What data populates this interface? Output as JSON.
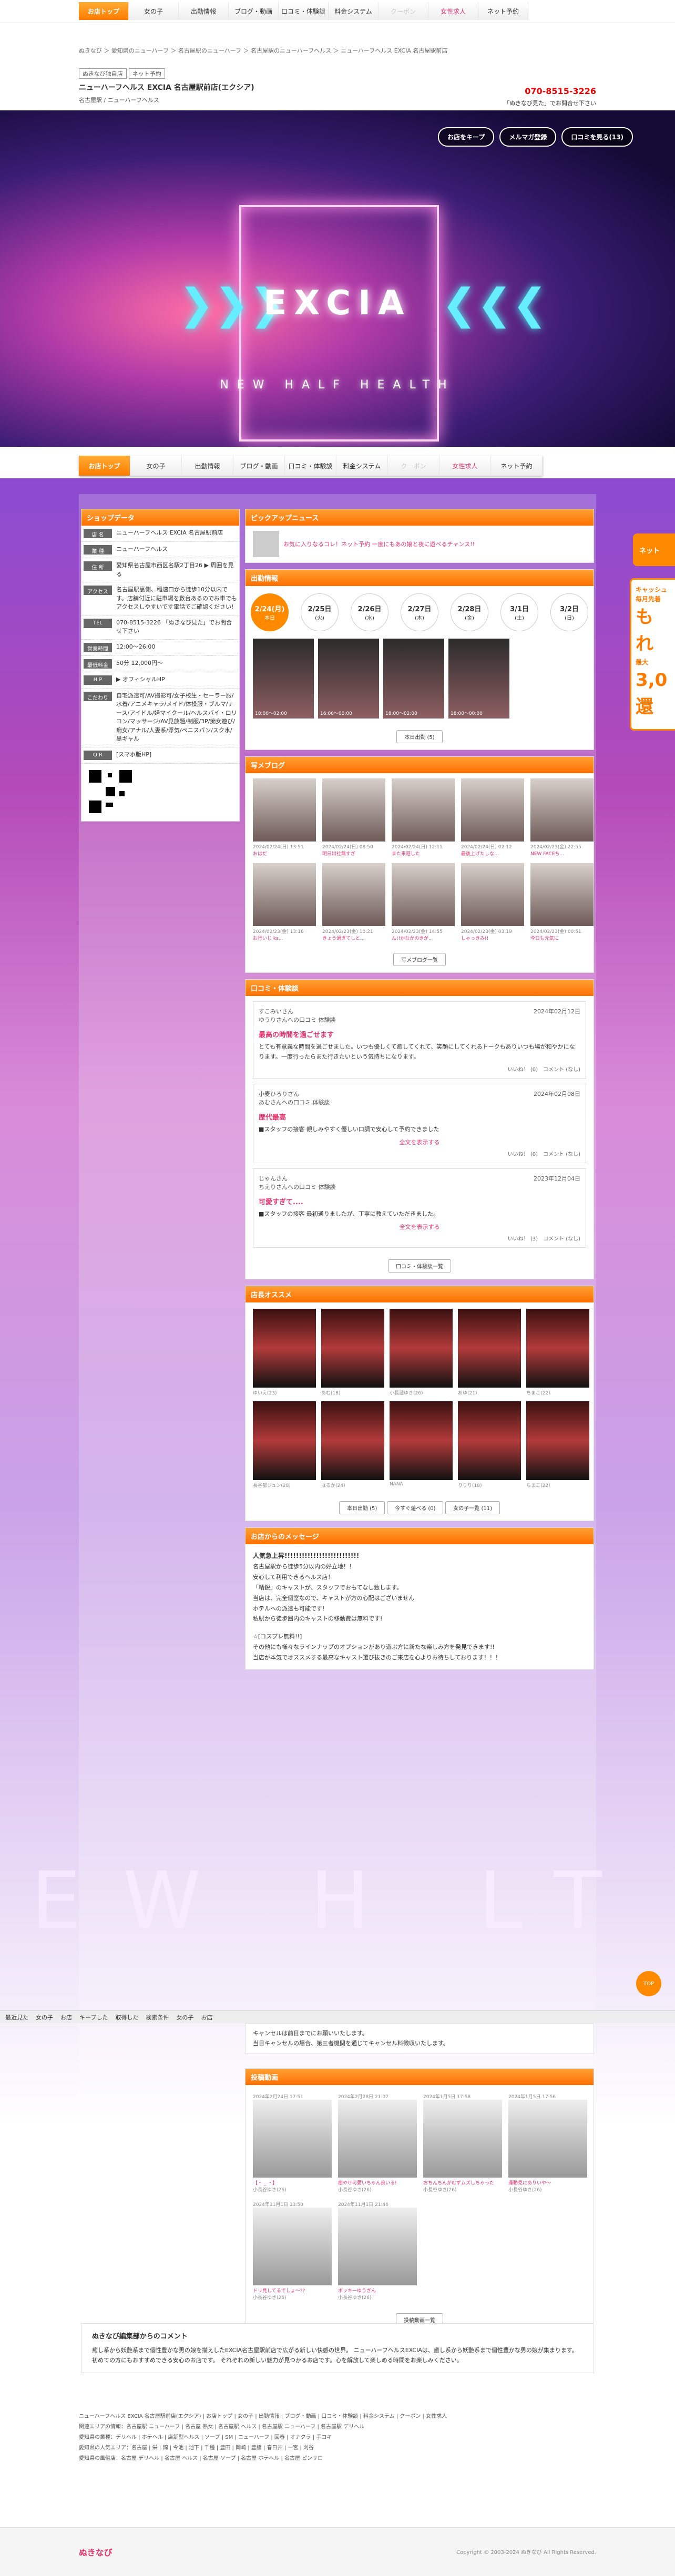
{
  "topnav": {
    "logo": "ぬきなび",
    "items": [
      "お店トップ",
      "女の子",
      "出勤情報",
      "ブログ・動画",
      "口コミ・体験談",
      "料金システム",
      "クーポン",
      "女性求人",
      "ネット予約"
    ]
  },
  "breadcrumb": "ぬきなび ＞ 愛知県のニューハーフ ＞ 名古屋駅のニューハーフ ＞ 名古屋駅のニューハーフヘルス ＞ ニューハーフヘルス EXCIA 名古屋駅前店",
  "shop": {
    "tags": [
      "ぬきなび独自店",
      "ネット予約"
    ],
    "name": "ニューハーフヘルス EXCIA 名古屋駅前店(エクシア)",
    "sub": "名古屋駅 / ニューハーフヘルス",
    "phone": "070-8515-3226",
    "phone_note": "「ぬきなび見た」でお問合せ下さい"
  },
  "hero": {
    "buttons": [
      "お店をキープ",
      "メルマガ登録",
      "口コミを見る(13)"
    ],
    "brand": "EXCIA",
    "tagline": "NEW HALF HEALTH",
    "chev_left": "❯❯❯",
    "chev_right": "❮❮❮"
  },
  "shopdata": {
    "title": "ショップデータ",
    "rows": [
      {
        "k": "店 名",
        "v": "ニューハーフヘルス EXCIA 名古屋駅前店"
      },
      {
        "k": "業 種",
        "v": "ニューハーフヘルス"
      },
      {
        "k": "住 所",
        "v": "愛知県名古屋市西区名駅2丁目26 ▶ 周囲を見る"
      },
      {
        "k": "アクセス",
        "v": "名古屋駅裏側、稲速口から徒歩10分以内です。店舗付近に駐車場を数台あるのでお車でもアクセスしやすいです電話でご確認ください!"
      },
      {
        "k": "TEL",
        "v": "070-8515-3226 「ぬきなび見た」でお問合せ下さい"
      },
      {
        "k": "営業時間",
        "v": "12:00〜26:00"
      },
      {
        "k": "最低料金",
        "v": "50分 12,000円〜"
      },
      {
        "k": "H P",
        "v": "▶ オフィシャルHP"
      },
      {
        "k": "こだわり",
        "v": "自宅派遣可/AV撮影可/女子校生・セーラー服/水着/アニメキャラ/メイド/体操服・ブルマ/ナース/アイドル/婦マイクール/ヘルスバイ・ロリコン/マッサージ/AV見放題/制服/3P/痴女遊び/痴女/アナル/人妻系/浮気/ペニスパン/スク水/黒ギャル"
      },
      {
        "k": "Q R",
        "v": "[スマホ版HP]"
      }
    ]
  },
  "pickup": {
    "title": "ピックアップニュース",
    "text": "お気に入りなるコレ！ネット予約 一度にもあの娘と夜に遊べるチャンス!!"
  },
  "schedule": {
    "title": "出勤情報",
    "days": [
      {
        "d": "2/24(月)",
        "s": "本日"
      },
      {
        "d": "2/25日",
        "s": "(火)"
      },
      {
        "d": "2/26日",
        "s": "(水)"
      },
      {
        "d": "2/27日",
        "s": "(木)"
      },
      {
        "d": "2/28日",
        "s": "(金)"
      },
      {
        "d": "3/1日",
        "s": "(土)"
      },
      {
        "d": "3/2日",
        "s": "(日)"
      }
    ],
    "girls": [
      "18:00〜02:00",
      "16:00〜00:00",
      "18:00〜02:00",
      "18:00〜00:00"
    ],
    "btn": "本日出勤 (5)"
  },
  "blog": {
    "title": "写メブログ",
    "items": [
      {
        "t": "2024/02/24(日) 13:51",
        "n": "おはだ"
      },
      {
        "t": "2024/02/24(日) 08:50",
        "n": "明日出社無すぎ"
      },
      {
        "t": "2024/02/24(日) 12:11",
        "n": "また来遊した"
      },
      {
        "t": "2024/02/24(日) 02:12",
        "n": "最後上げたしな..."
      },
      {
        "t": "2024/02/23(金) 22:55",
        "n": "NEW FACEち..."
      },
      {
        "t": "2024/02/23(金) 13:16",
        "n": "お行いじ ks..."
      },
      {
        "t": "2024/02/23(金) 10:21",
        "n": "きょう過ぎてしと..."
      },
      {
        "t": "2024/02/23(金) 14:55",
        "n": "ん!!かなかのきが.."
      },
      {
        "t": "2024/02/23(金) 03:19",
        "n": "しゃっきみ!!"
      },
      {
        "t": "2024/02/23(金) 00:51",
        "n": "今日も元気に"
      }
    ],
    "btn": "写メブログ一覧"
  },
  "reviews": {
    "title": "口コミ・体験談",
    "items": [
      {
        "u": "すこみいさん",
        "to": "ゆうりさんへの口コミ 体験談",
        "date": "2024年02月12日",
        "title": "最高の時間を過ごせます",
        "body": "とても有意義な時間を過ごせました。いつも優しくて癒してくれて、笑顔にしてくれるトークもありいつも場が和やかになります。一度行ったらまた行きたいという気持ちになります。",
        "more": "",
        "likes": "いいね！ (0)",
        "cmt": "コメント (なし)"
      },
      {
        "u": "小麦ひろりさん",
        "to": "あむさんへの口コミ 体験談",
        "date": "2024年02月08日",
        "title": "歴代最高",
        "body": "■スタッフの接客 親しみやすく優しい口調で安心して予約できました",
        "more": "全文を表示する",
        "likes": "いいね！ (0)",
        "cmt": "コメント (なし)"
      },
      {
        "u": "じゃんさん",
        "to": "ちえりさんへの口コミ 体験談",
        "date": "2023年12月04日",
        "title": "可愛すぎて....",
        "body": "■スタッフの接客 最初通りましたが、丁寧に教えていただきました。",
        "more": "全文を表示する",
        "likes": "いいね！ (3)",
        "cmt": "コメント (なし)"
      }
    ],
    "btn": "口コミ・体験談一覧"
  },
  "recommend": {
    "title": "店長オススメ",
    "girls": [
      "ゆいえ(23)",
      "あむ(18)",
      "小長遊ゆき(26)",
      "あゆ(21)",
      "ちまこ(22)",
      "長谷部ジュン(28)",
      "はるか(24)",
      "NANA",
      "りりり(18)",
      "ちまこ(22)"
    ],
    "btns": [
      "本日出勤 (5)",
      "今すぐ遊べる (0)",
      "女の子一覧 (11)"
    ]
  },
  "message": {
    "title": "お店からのメッセージ",
    "heading": "人気急上昇!!!!!!!!!!!!!!!!!!!!!!!!!!",
    "lines": [
      "名古屋駅から徒歩5分以内の好立地！！",
      "安心して利用できるヘルス店！",
      "「精鋭」のキャストが、スタッフでおもてなし致します。",
      "当店は、完全個室なので、キャストが方の心配はございません",
      "ホテルへの派遣も可能です!",
      "私駅から徒歩圏内のキャストの移動費は無料です!",
      "",
      "☆[コスプレ無料!!]",
      "その他にも様々なラインナップのオプションがあり遊ぶ方に新たな楽しみ方を発見できます!!",
      "当店が本気でオススメする最高なキャスト選び抜きのご来店を心よりお待ちしております！！！"
    ],
    "notes": [
      "キャンセルは前日までにお願いいたします。",
      "当日キャンセルの場合、第三者機関を通じてキャンセル料徴収いたします。"
    ]
  },
  "bottombar": [
    "最近見た",
    "女の子",
    "お店",
    "キープした",
    "取得した",
    "検索条件",
    "女の子",
    "お店"
  ],
  "posts": {
    "title": "投稿動画",
    "items": [
      {
        "t": "2024年2月24日 17:51",
        "n": "【・ _ ・】",
        "g": "小長谷ゆき(26)"
      },
      {
        "t": "2024年2月28日 21:07",
        "n": "癒やせ可愛いちゃん良いる!",
        "g": "小長谷ゆき(26)"
      },
      {
        "t": "2024年1月5日 17:58",
        "n": "おちんちんがむずムズしちゃった",
        "g": "小長谷ゆき(26)"
      },
      {
        "t": "2024年1月5日 17:56",
        "n": "運動見にありいや〜",
        "g": "小長谷ゆき(26)"
      },
      {
        "t": "2024年11月1日 13:50",
        "n": "ドリ見してるでしょ〜??",
        "g": "小長谷ゆき(26)"
      },
      {
        "t": "2024年11月1日 21:46",
        "n": "ボッキーゆうぎん",
        "g": "小長谷ゆき(26)"
      }
    ],
    "btn": "投稿動画一覧"
  },
  "editor": {
    "title": "ぬきなび編集部からのコメント",
    "body": "癒し系から妖艶系まで個性豊かな男の娘を揃えしたEXCIA名古屋駅前店で広がる新しい快感の世界。 ニューハーフヘルスEXCIAは、癒し系から妖艶系まで個性豊かな男の娘が集まります。初めての方にもおすすめできる安心のお店です。 それぞれの新しい魅力が見つかるお店です。心を解放して楽しめる時間をお楽しみください。"
  },
  "footer": {
    "lines": [
      "ニューハーフヘルス EXCIA 名古屋駅前店(エクシア) | お店トップ | 女の子 | 出勤情報 | ブログ・動画 | 口コミ・体験談 | 料金システム | クーポン | 女性求人",
      "関連エリアの情報：名古屋駅 ニューハーフ | 名古屋 熟女 | 名古屋駅 ヘルス | 名古屋駅 ニューハーフ | 名古屋駅 デリヘル",
      "愛知県の業種：デリヘル | ホテヘル | 店舗型ヘルス | ソープ | SM | ニューハーフ | 回春 | オナクラ | 手コキ",
      "愛知県の人気エリア：名古屋 | 栄 | 錦 | 今池 | 池下 | 千種 | 豊田 | 岡崎 | 豊橋 | 春日井 | 一宮 | 刈谷",
      "愛知県の風俗店：名古屋 デリヘル | 名古屋 ヘルス | 名古屋 ソープ | 名古屋 ホテヘル | 名古屋 ピンサロ"
    ],
    "copyright": "Copyright © 2003-2024 ぬきなび All Rights Reserved."
  },
  "float": {
    "a": "ネット",
    "b1": "キャッシュ",
    "b2": "毎月先着",
    "b3": "もれ",
    "b4": "最大",
    "b5": "3,0",
    "b6": "還"
  },
  "totop": "TOP",
  "watermark": "EW H LT",
  "colors": {
    "accent": "#ff7a00",
    "pink": "#e8336d"
  }
}
